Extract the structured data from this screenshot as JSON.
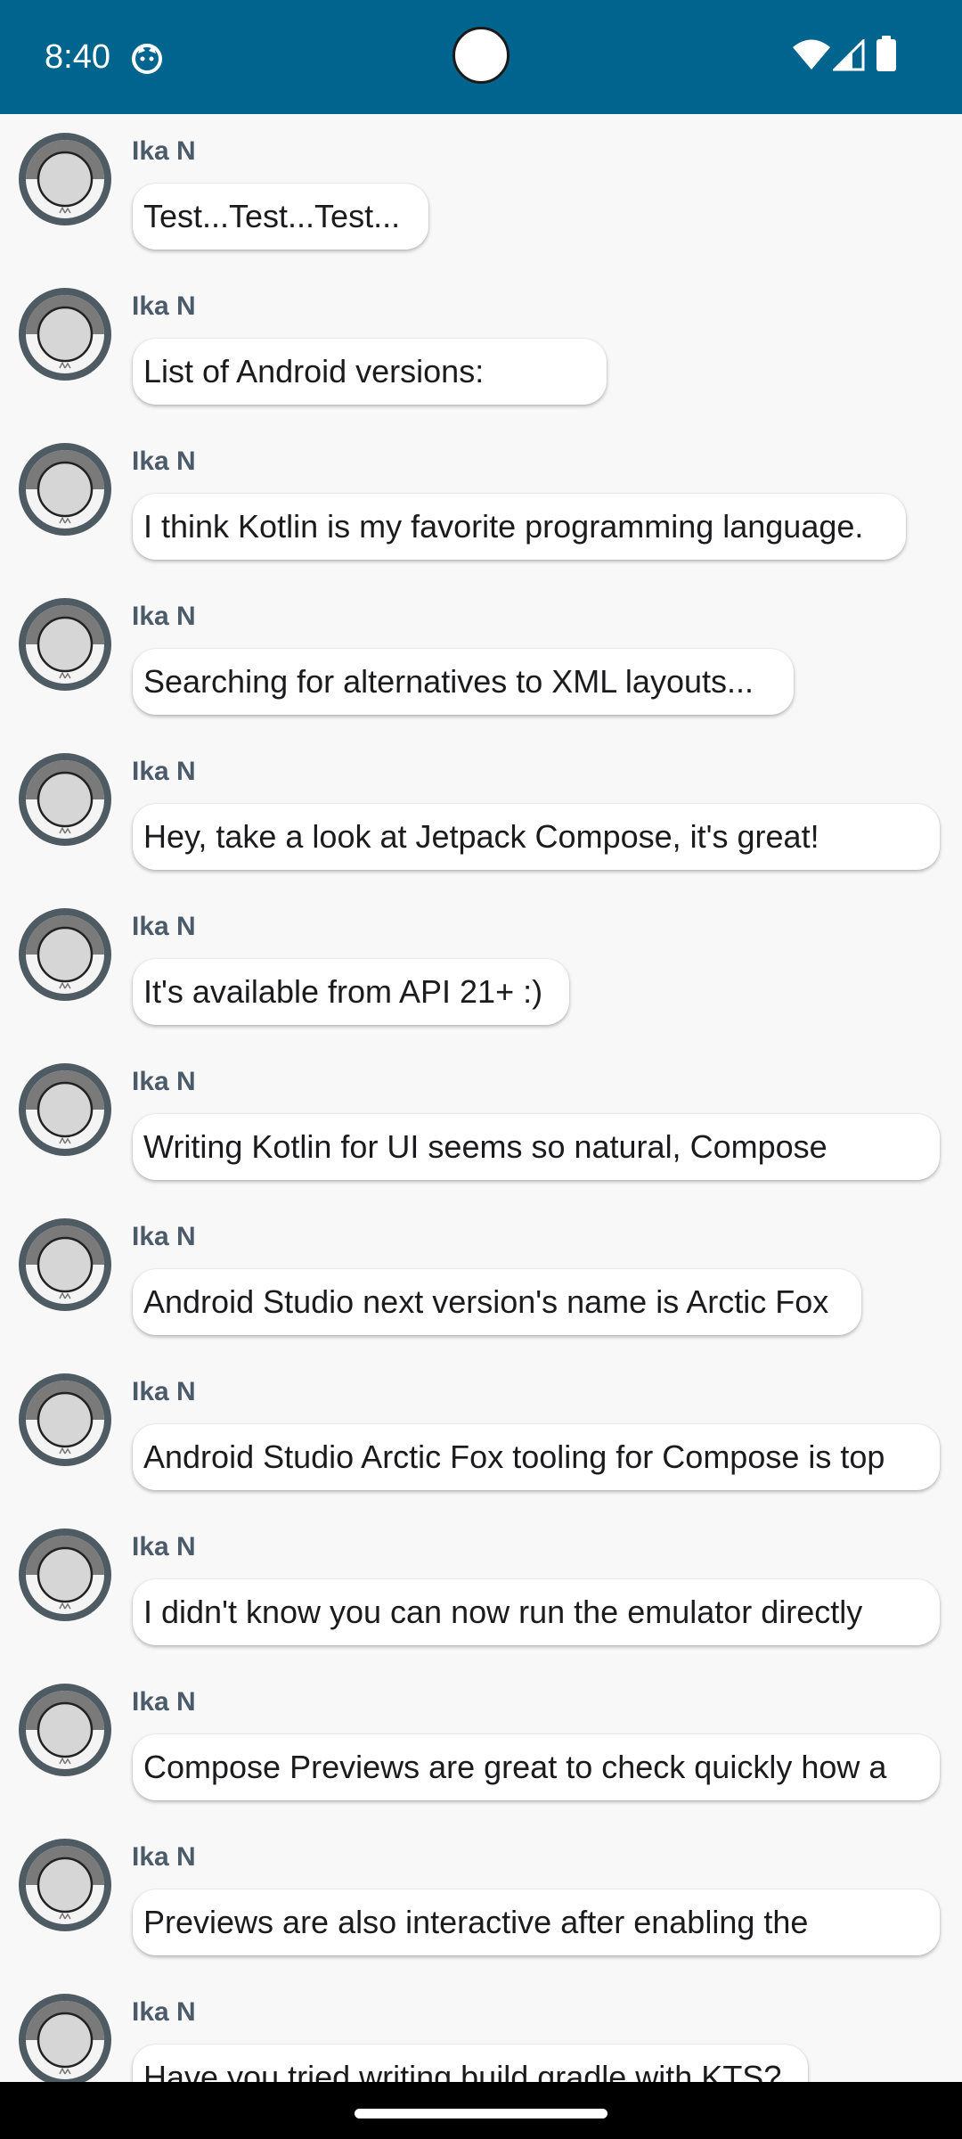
{
  "status_bar": {
    "time": "8:40",
    "background_color": "#00658e",
    "icons": [
      "app-notification-icon",
      "wifi-icon",
      "signal-icon",
      "battery-icon"
    ]
  },
  "messages": [
    {
      "author": "Ika N",
      "body": "Test...Test...Test..."
    },
    {
      "author": "Ika N",
      "body": "List of Android versions:"
    },
    {
      "author": "Ika N",
      "body": "I think Kotlin is my favorite programming language."
    },
    {
      "author": "Ika N",
      "body": "Searching for alternatives to XML layouts..."
    },
    {
      "author": "Ika N",
      "body": "Hey, take a look at Jetpack Compose, it's great!"
    },
    {
      "author": "Ika N",
      "body": "It's available from API 21+ :)"
    },
    {
      "author": "Ika N",
      "body": "Writing Kotlin for UI seems so natural, Compose"
    },
    {
      "author": "Ika N",
      "body": "Android Studio next version's name is Arctic Fox"
    },
    {
      "author": "Ika N",
      "body": "Android Studio Arctic Fox tooling for Compose is top"
    },
    {
      "author": "Ika N",
      "body": "I didn't know you can now run the emulator directly"
    },
    {
      "author": "Ika N",
      "body": "Compose Previews are great to check quickly how a"
    },
    {
      "author": "Ika N",
      "body": "Previews are also interactive after enabling the"
    },
    {
      "author": "Ika N",
      "body": "Have you tried writing build.gradle with KTS?"
    }
  ]
}
